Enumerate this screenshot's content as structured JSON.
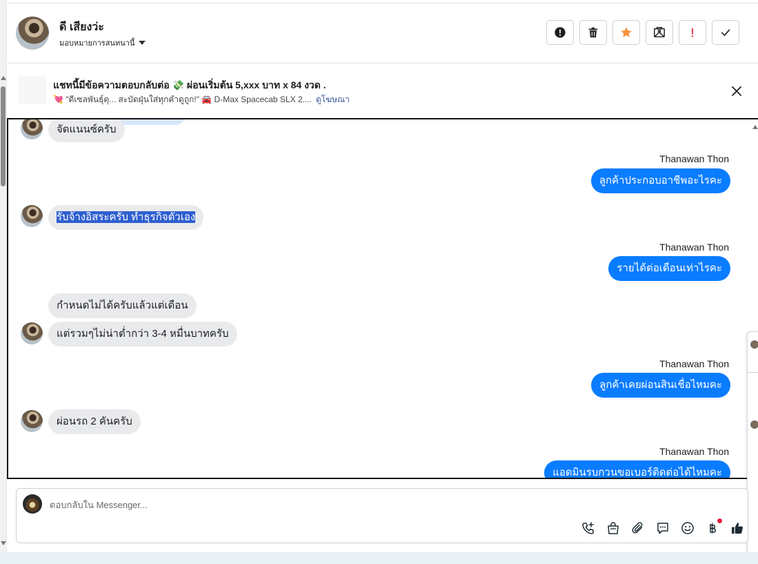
{
  "header": {
    "contact_name": "ดี เสียงว่ะ",
    "assign_label": "มอบหมายการสนทนานี้",
    "toolbar": [
      {
        "name": "report-button",
        "icon": "alert-circle-icon",
        "color": "#1c1e21"
      },
      {
        "name": "delete-button",
        "icon": "trash-icon",
        "color": "#1c1e21"
      },
      {
        "name": "star-button",
        "icon": "star-icon",
        "color": "#f7923a"
      },
      {
        "name": "mark-unread-button",
        "icon": "envelope-x-icon",
        "color": "#1c1e21"
      },
      {
        "name": "mark-spam-button",
        "icon": "exclamation-icon",
        "color": "#e41e3f"
      },
      {
        "name": "mark-done-button",
        "icon": "check-icon",
        "color": "#1c1e21"
      }
    ]
  },
  "ad": {
    "title": "แชทนี้มีข้อความตอบกลับต่อ 💸 ผ่อนเริ่มต้น 5,xxx บาท x 84 งวด .",
    "subtitle": "💘 \"ดีเซลพันธุ์ดุ... สะบัดฝุ่นใส่ทุกคำดูถูก!\" 🚘 D-Max Spacecab SLX 2....",
    "link": "ดูโฆษณา"
  },
  "messages": [
    {
      "dir": "in",
      "text": "จัดแนนซ์ครับ",
      "avatar": true
    },
    {
      "dir": "out",
      "sender": "Thanawan Thon",
      "text": "ลูกค้าประกอบอาชีพอะไรคะ"
    },
    {
      "dir": "in",
      "text": "รับจ้างอิสระครับ ทำธุรกิจตัวเอง",
      "avatar": true,
      "selected": true
    },
    {
      "dir": "out",
      "sender": "Thanawan Thon",
      "text": "รายได้ต่อเดือนเท่าไรคะ"
    },
    {
      "dir": "in",
      "text": "กำหนดไม่ได้ครับแล้วแต่เดือน",
      "avatar": false
    },
    {
      "dir": "in",
      "text": "แต่รวมๆไม่น่าต่ำกว่า 3-4 หมื่นบาทครับ",
      "avatar": true
    },
    {
      "dir": "out",
      "sender": "Thanawan Thon",
      "text": "ลูกค้าเคยผ่อนสินเชื่อไหมคะ"
    },
    {
      "dir": "in",
      "text": "ผ่อนรถ 2 คันครับ",
      "avatar": true
    },
    {
      "dir": "out",
      "sender": "Thanawan Thon",
      "text": "แอดมินรบกวนขอเบอร์ติดต่อได้ไหมคะ"
    }
  ],
  "composer": {
    "placeholder": "ตอบกลับใน Messenger...",
    "icons": [
      "phone-add-icon",
      "shopping-bag-icon",
      "paperclip-icon",
      "chat-bubble-icon",
      "emoji-icon",
      "baht-icon",
      "thumbs-up-icon"
    ],
    "accent": "#1c2b33",
    "notify_dot_color": "#e41e3f"
  },
  "colors": {
    "outgoing_bubble": "#0a7cff",
    "incoming_bubble": "#e9eaec",
    "selection": "#2f5fd0"
  }
}
